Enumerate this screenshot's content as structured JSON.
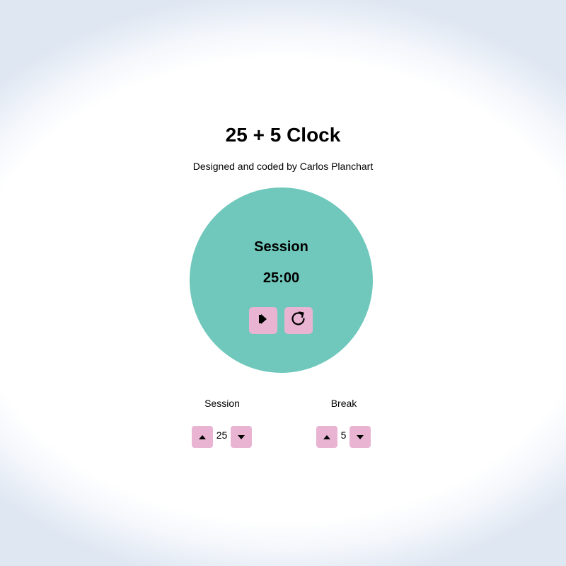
{
  "header": {
    "title": "25 + 5 Clock",
    "subtitle": "Designed and coded by Carlos Planchart"
  },
  "timer": {
    "label": "Session",
    "time": "25:00",
    "controls": [
      {
        "name": "play",
        "icon": "play-pause-icon"
      },
      {
        "name": "reset",
        "icon": "refresh-icon"
      }
    ]
  },
  "settings": {
    "session": {
      "label": "Session",
      "value": "25",
      "increment_icon": "arrow-up-icon",
      "decrement_icon": "arrow-down-icon"
    },
    "break": {
      "label": "Break",
      "value": "5",
      "increment_icon": "arrow-up-icon",
      "decrement_icon": "arrow-down-icon"
    }
  },
  "colors": {
    "circle": "#6fc8bb",
    "button": "#e8b4d2",
    "text": "#000000"
  }
}
